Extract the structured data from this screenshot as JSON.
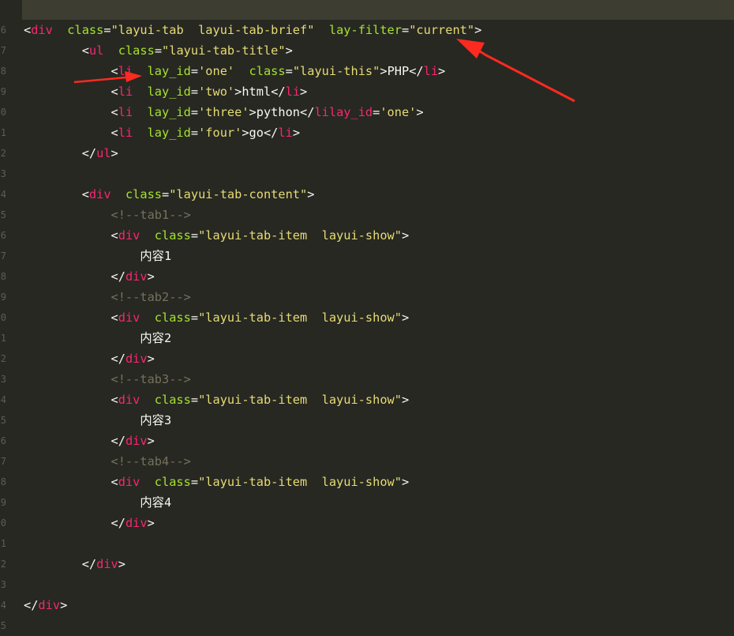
{
  "editor": {
    "gutter_numbers": [
      "6",
      "7",
      "8",
      "9",
      "0",
      "1",
      "2",
      "3",
      "4",
      "5",
      "6",
      "7",
      "8",
      "9",
      "0",
      "1",
      "2",
      "3",
      "4",
      "5",
      "6",
      "7",
      "8",
      "9",
      "0",
      "1",
      "2",
      "3",
      "4",
      "5"
    ],
    "lines": [
      [
        {
          "c": "p",
          "t": "<"
        },
        {
          "c": "t",
          "t": "div"
        },
        {
          "c": "x",
          "t": "  "
        },
        {
          "c": "a",
          "t": "class"
        },
        {
          "c": "p",
          "t": "="
        },
        {
          "c": "s",
          "t": "\"layui-tab  layui-tab-brief\""
        },
        {
          "c": "x",
          "t": "  "
        },
        {
          "c": "a",
          "t": "lay-filter"
        },
        {
          "c": "p",
          "t": "="
        },
        {
          "c": "s",
          "t": "\"current\""
        },
        {
          "c": "p",
          "t": ">"
        }
      ],
      [
        {
          "c": "x",
          "t": "    "
        },
        {
          "c": "p",
          "t": "<"
        },
        {
          "c": "t",
          "t": "ul"
        },
        {
          "c": "x",
          "t": "  "
        },
        {
          "c": "a",
          "t": "class"
        },
        {
          "c": "p",
          "t": "="
        },
        {
          "c": "s",
          "t": "\"layui-tab-title\""
        },
        {
          "c": "p",
          "t": ">"
        }
      ],
      [
        {
          "c": "x",
          "t": "      "
        },
        {
          "c": "p",
          "t": "<"
        },
        {
          "c": "t",
          "t": "li"
        },
        {
          "c": "x",
          "t": "  "
        },
        {
          "c": "a",
          "t": "lay_id"
        },
        {
          "c": "p",
          "t": "="
        },
        {
          "c": "s",
          "t": "'one'"
        },
        {
          "c": "x",
          "t": "  "
        },
        {
          "c": "a",
          "t": "class"
        },
        {
          "c": "p",
          "t": "="
        },
        {
          "c": "s",
          "t": "\"layui-this\""
        },
        {
          "c": "p",
          "t": ">"
        },
        {
          "c": "x",
          "t": "PHP"
        },
        {
          "c": "p",
          "t": "</"
        },
        {
          "c": "t",
          "t": "li"
        },
        {
          "c": "p",
          "t": ">"
        }
      ],
      [
        {
          "c": "x",
          "t": "      "
        },
        {
          "c": "p",
          "t": "<"
        },
        {
          "c": "t",
          "t": "li"
        },
        {
          "c": "x",
          "t": "  "
        },
        {
          "c": "a",
          "t": "lay_id"
        },
        {
          "c": "p",
          "t": "="
        },
        {
          "c": "s",
          "t": "'two'"
        },
        {
          "c": "p",
          "t": ">"
        },
        {
          "c": "x",
          "t": "html"
        },
        {
          "c": "p",
          "t": "</"
        },
        {
          "c": "t",
          "t": "li"
        },
        {
          "c": "p",
          "t": ">"
        }
      ],
      [
        {
          "c": "x",
          "t": "      "
        },
        {
          "c": "p",
          "t": "<"
        },
        {
          "c": "t",
          "t": "li"
        },
        {
          "c": "x",
          "t": "  "
        },
        {
          "c": "a",
          "t": "lay_id"
        },
        {
          "c": "p",
          "t": "="
        },
        {
          "c": "s",
          "t": "'three'"
        },
        {
          "c": "p",
          "t": ">"
        },
        {
          "c": "x",
          "t": "python"
        },
        {
          "c": "p",
          "t": "</"
        },
        {
          "c": "t",
          "t": "lilay_id"
        },
        {
          "c": "p",
          "t": "="
        },
        {
          "c": "s",
          "t": "'one'"
        },
        {
          "c": "p",
          "t": ">"
        }
      ],
      [
        {
          "c": "x",
          "t": "      "
        },
        {
          "c": "p",
          "t": "<"
        },
        {
          "c": "t",
          "t": "li"
        },
        {
          "c": "x",
          "t": "  "
        },
        {
          "c": "a",
          "t": "lay_id"
        },
        {
          "c": "p",
          "t": "="
        },
        {
          "c": "s",
          "t": "'four'"
        },
        {
          "c": "p",
          "t": ">"
        },
        {
          "c": "x",
          "t": "go"
        },
        {
          "c": "p",
          "t": "</"
        },
        {
          "c": "t",
          "t": "li"
        },
        {
          "c": "p",
          "t": ">"
        }
      ],
      [
        {
          "c": "x",
          "t": "    "
        },
        {
          "c": "p",
          "t": "</"
        },
        {
          "c": "t",
          "t": "ul"
        },
        {
          "c": "p",
          "t": ">"
        }
      ],
      [],
      [
        {
          "c": "x",
          "t": "    "
        },
        {
          "c": "p",
          "t": "<"
        },
        {
          "c": "t",
          "t": "div"
        },
        {
          "c": "x",
          "t": "  "
        },
        {
          "c": "a",
          "t": "class"
        },
        {
          "c": "p",
          "t": "="
        },
        {
          "c": "s",
          "t": "\"layui-tab-content\""
        },
        {
          "c": "p",
          "t": ">"
        }
      ],
      [
        {
          "c": "x",
          "t": "      "
        },
        {
          "c": "c",
          "t": "<!--tab1-->"
        }
      ],
      [
        {
          "c": "x",
          "t": "      "
        },
        {
          "c": "p",
          "t": "<"
        },
        {
          "c": "t",
          "t": "div"
        },
        {
          "c": "x",
          "t": "  "
        },
        {
          "c": "a",
          "t": "class"
        },
        {
          "c": "p",
          "t": "="
        },
        {
          "c": "s",
          "t": "\"layui-tab-item  layui-show\""
        },
        {
          "c": "p",
          "t": ">"
        }
      ],
      [
        {
          "c": "x",
          "t": "        内容1"
        }
      ],
      [
        {
          "c": "x",
          "t": "      "
        },
        {
          "c": "p",
          "t": "</"
        },
        {
          "c": "t",
          "t": "div"
        },
        {
          "c": "p",
          "t": ">"
        }
      ],
      [
        {
          "c": "x",
          "t": "      "
        },
        {
          "c": "c",
          "t": "<!--tab2-->"
        }
      ],
      [
        {
          "c": "x",
          "t": "      "
        },
        {
          "c": "p",
          "t": "<"
        },
        {
          "c": "t",
          "t": "div"
        },
        {
          "c": "x",
          "t": "  "
        },
        {
          "c": "a",
          "t": "class"
        },
        {
          "c": "p",
          "t": "="
        },
        {
          "c": "s",
          "t": "\"layui-tab-item  layui-show\""
        },
        {
          "c": "p",
          "t": ">"
        }
      ],
      [
        {
          "c": "x",
          "t": "        内容2"
        }
      ],
      [
        {
          "c": "x",
          "t": "      "
        },
        {
          "c": "p",
          "t": "</"
        },
        {
          "c": "t",
          "t": "div"
        },
        {
          "c": "p",
          "t": ">"
        }
      ],
      [
        {
          "c": "x",
          "t": "      "
        },
        {
          "c": "c",
          "t": "<!--tab3-->"
        }
      ],
      [
        {
          "c": "x",
          "t": "      "
        },
        {
          "c": "p",
          "t": "<"
        },
        {
          "c": "t",
          "t": "div"
        },
        {
          "c": "x",
          "t": "  "
        },
        {
          "c": "a",
          "t": "class"
        },
        {
          "c": "p",
          "t": "="
        },
        {
          "c": "s",
          "t": "\"layui-tab-item  layui-show\""
        },
        {
          "c": "p",
          "t": ">"
        }
      ],
      [
        {
          "c": "x",
          "t": "        内容3"
        }
      ],
      [
        {
          "c": "x",
          "t": "      "
        },
        {
          "c": "p",
          "t": "</"
        },
        {
          "c": "t",
          "t": "div"
        },
        {
          "c": "p",
          "t": ">"
        }
      ],
      [
        {
          "c": "x",
          "t": "      "
        },
        {
          "c": "c",
          "t": "<!--tab4-->"
        }
      ],
      [
        {
          "c": "x",
          "t": "      "
        },
        {
          "c": "p",
          "t": "<"
        },
        {
          "c": "t",
          "t": "div"
        },
        {
          "c": "x",
          "t": "  "
        },
        {
          "c": "a",
          "t": "class"
        },
        {
          "c": "p",
          "t": "="
        },
        {
          "c": "s",
          "t": "\"layui-tab-item  layui-show\""
        },
        {
          "c": "p",
          "t": ">"
        }
      ],
      [
        {
          "c": "x",
          "t": "        内容4"
        }
      ],
      [
        {
          "c": "x",
          "t": "      "
        },
        {
          "c": "p",
          "t": "</"
        },
        {
          "c": "t",
          "t": "div"
        },
        {
          "c": "p",
          "t": ">"
        }
      ],
      [],
      [
        {
          "c": "x",
          "t": "    "
        },
        {
          "c": "p",
          "t": "</"
        },
        {
          "c": "t",
          "t": "div"
        },
        {
          "c": "p",
          "t": ">"
        }
      ],
      [],
      [
        {
          "c": "p",
          "t": "</"
        },
        {
          "c": "t",
          "t": "div"
        },
        {
          "c": "p",
          "t": ">"
        }
      ]
    ]
  },
  "colors": {
    "background": "#272822",
    "current_line": "#3e3d32",
    "tag": "#f92672",
    "attribute": "#a6e22e",
    "string": "#e6db74",
    "comment": "#75715e",
    "text": "#f8f8f2",
    "annotation_arrow": "#ff2a1f"
  },
  "annotations": [
    {
      "name": "arrow-to-lay-filter",
      "icon": "red-arrow-icon"
    },
    {
      "name": "arrow-to-lay-id",
      "icon": "red-arrow-icon"
    }
  ]
}
